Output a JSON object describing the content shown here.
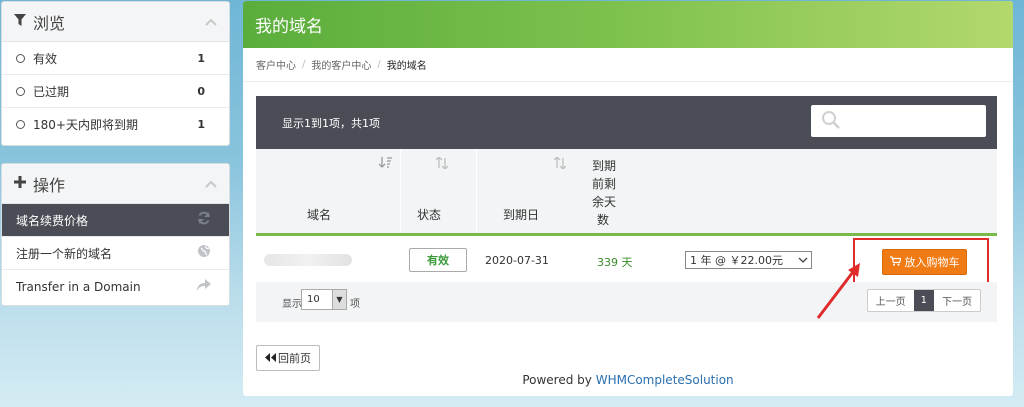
{
  "browse": {
    "title": "浏览",
    "items": [
      {
        "label": "有效",
        "count": "1"
      },
      {
        "label": "已过期",
        "count": "0"
      },
      {
        "label": "180+天内即将到期",
        "count": "1"
      }
    ]
  },
  "actions": {
    "title": "操作",
    "items": [
      {
        "label": "域名续费价格"
      },
      {
        "label": "注册一个新的域名"
      },
      {
        "label": "Transfer in a Domain"
      }
    ]
  },
  "main": {
    "title": "我的域名",
    "breadcrumb": [
      "客户中心",
      "我的客户中心",
      "我的域名"
    ],
    "table_info": "显示1到1项，共1项",
    "columns": [
      "域名",
      "状态",
      "到期日",
      "到期前剩余天数"
    ],
    "col_days_lines": [
      "到期",
      "前剩",
      "余天",
      "数"
    ],
    "row": {
      "status": "有效",
      "expiry": "2020-07-31",
      "days_left": "339 天",
      "renew_option": "1 年 @ ￥22.00元",
      "cart_button": "放入购物车"
    },
    "length": {
      "prefix": "显示",
      "value": "10",
      "suffix": "项"
    },
    "pager": {
      "prev": "上一页",
      "page": "1",
      "next": "下一页"
    },
    "back_button": "回前页",
    "powered_prefix": "Powered by ",
    "powered_link": "WHMCompleteSolution"
  },
  "colors": {
    "accent_green": "#6bb544",
    "cart_orange": "#f07b15",
    "highlight_red": "#e02b2b"
  }
}
